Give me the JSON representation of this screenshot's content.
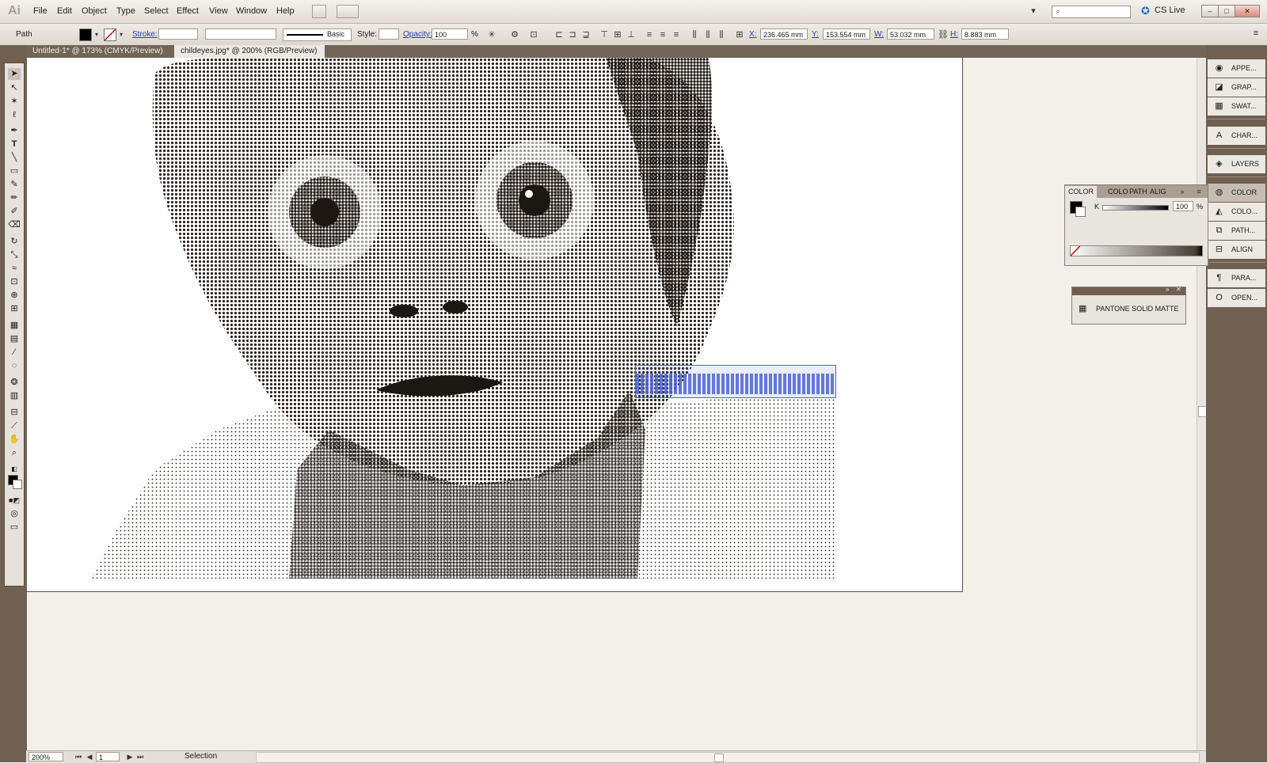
{
  "app": {
    "logo": "Ai",
    "menus": [
      "File",
      "Edit",
      "Object",
      "Type",
      "Select",
      "Effect",
      "View",
      "Window",
      "Help"
    ],
    "cs_live": "CS Live"
  },
  "control": {
    "selection_type": "Path",
    "stroke_label": "Stroke:",
    "brush_label": "Basic",
    "style_label": "Style:",
    "opacity_label": "Opacity:",
    "opacity_value": "100",
    "opacity_unit": "%",
    "x_label": "X:",
    "x_value": "236.465 mm",
    "y_label": "Y:",
    "y_value": "153.554 mm",
    "w_label": "W:",
    "w_value": "53.032 mm",
    "h_label": "H:",
    "h_value": "8.883 mm"
  },
  "tabs": [
    {
      "label": "Untitled-1* @ 173% (CMYK/Preview)",
      "active": false
    },
    {
      "label": "childeyes.jpg* @ 200% (RGB/Preview)",
      "active": true
    }
  ],
  "status": {
    "zoom": "200%",
    "page": "1",
    "tool": "Selection"
  },
  "dock": [
    {
      "label": "APPE...",
      "icon": "appearance-icon"
    },
    {
      "label": "GRAP...",
      "icon": "graphic-styles-icon"
    },
    {
      "label": "SWAT...",
      "icon": "swatches-icon"
    },
    {
      "label": "CHAR...",
      "icon": "character-icon"
    },
    {
      "label": "LAYERS",
      "icon": "layers-icon"
    },
    {
      "label": "COLOR",
      "icon": "color-icon"
    },
    {
      "label": "COLO...",
      "icon": "color-guide-icon"
    },
    {
      "label": "PATH...",
      "icon": "pathfinder-icon"
    },
    {
      "label": "ALIGN",
      "icon": "align-icon"
    },
    {
      "label": "PARA...",
      "icon": "paragraph-icon"
    },
    {
      "label": "OPEN...",
      "icon": "opentype-icon"
    }
  ],
  "color_panel": {
    "tabs": [
      "COLOR",
      "COLO",
      "PATH",
      "ALIG"
    ],
    "channel": "K",
    "value": "100",
    "unit": "%"
  },
  "pantone_panel": {
    "label": "PANTONE SOLID MATTE"
  },
  "colors": {
    "dock_bg": "#6f6052",
    "selection": "#4a63d6"
  }
}
